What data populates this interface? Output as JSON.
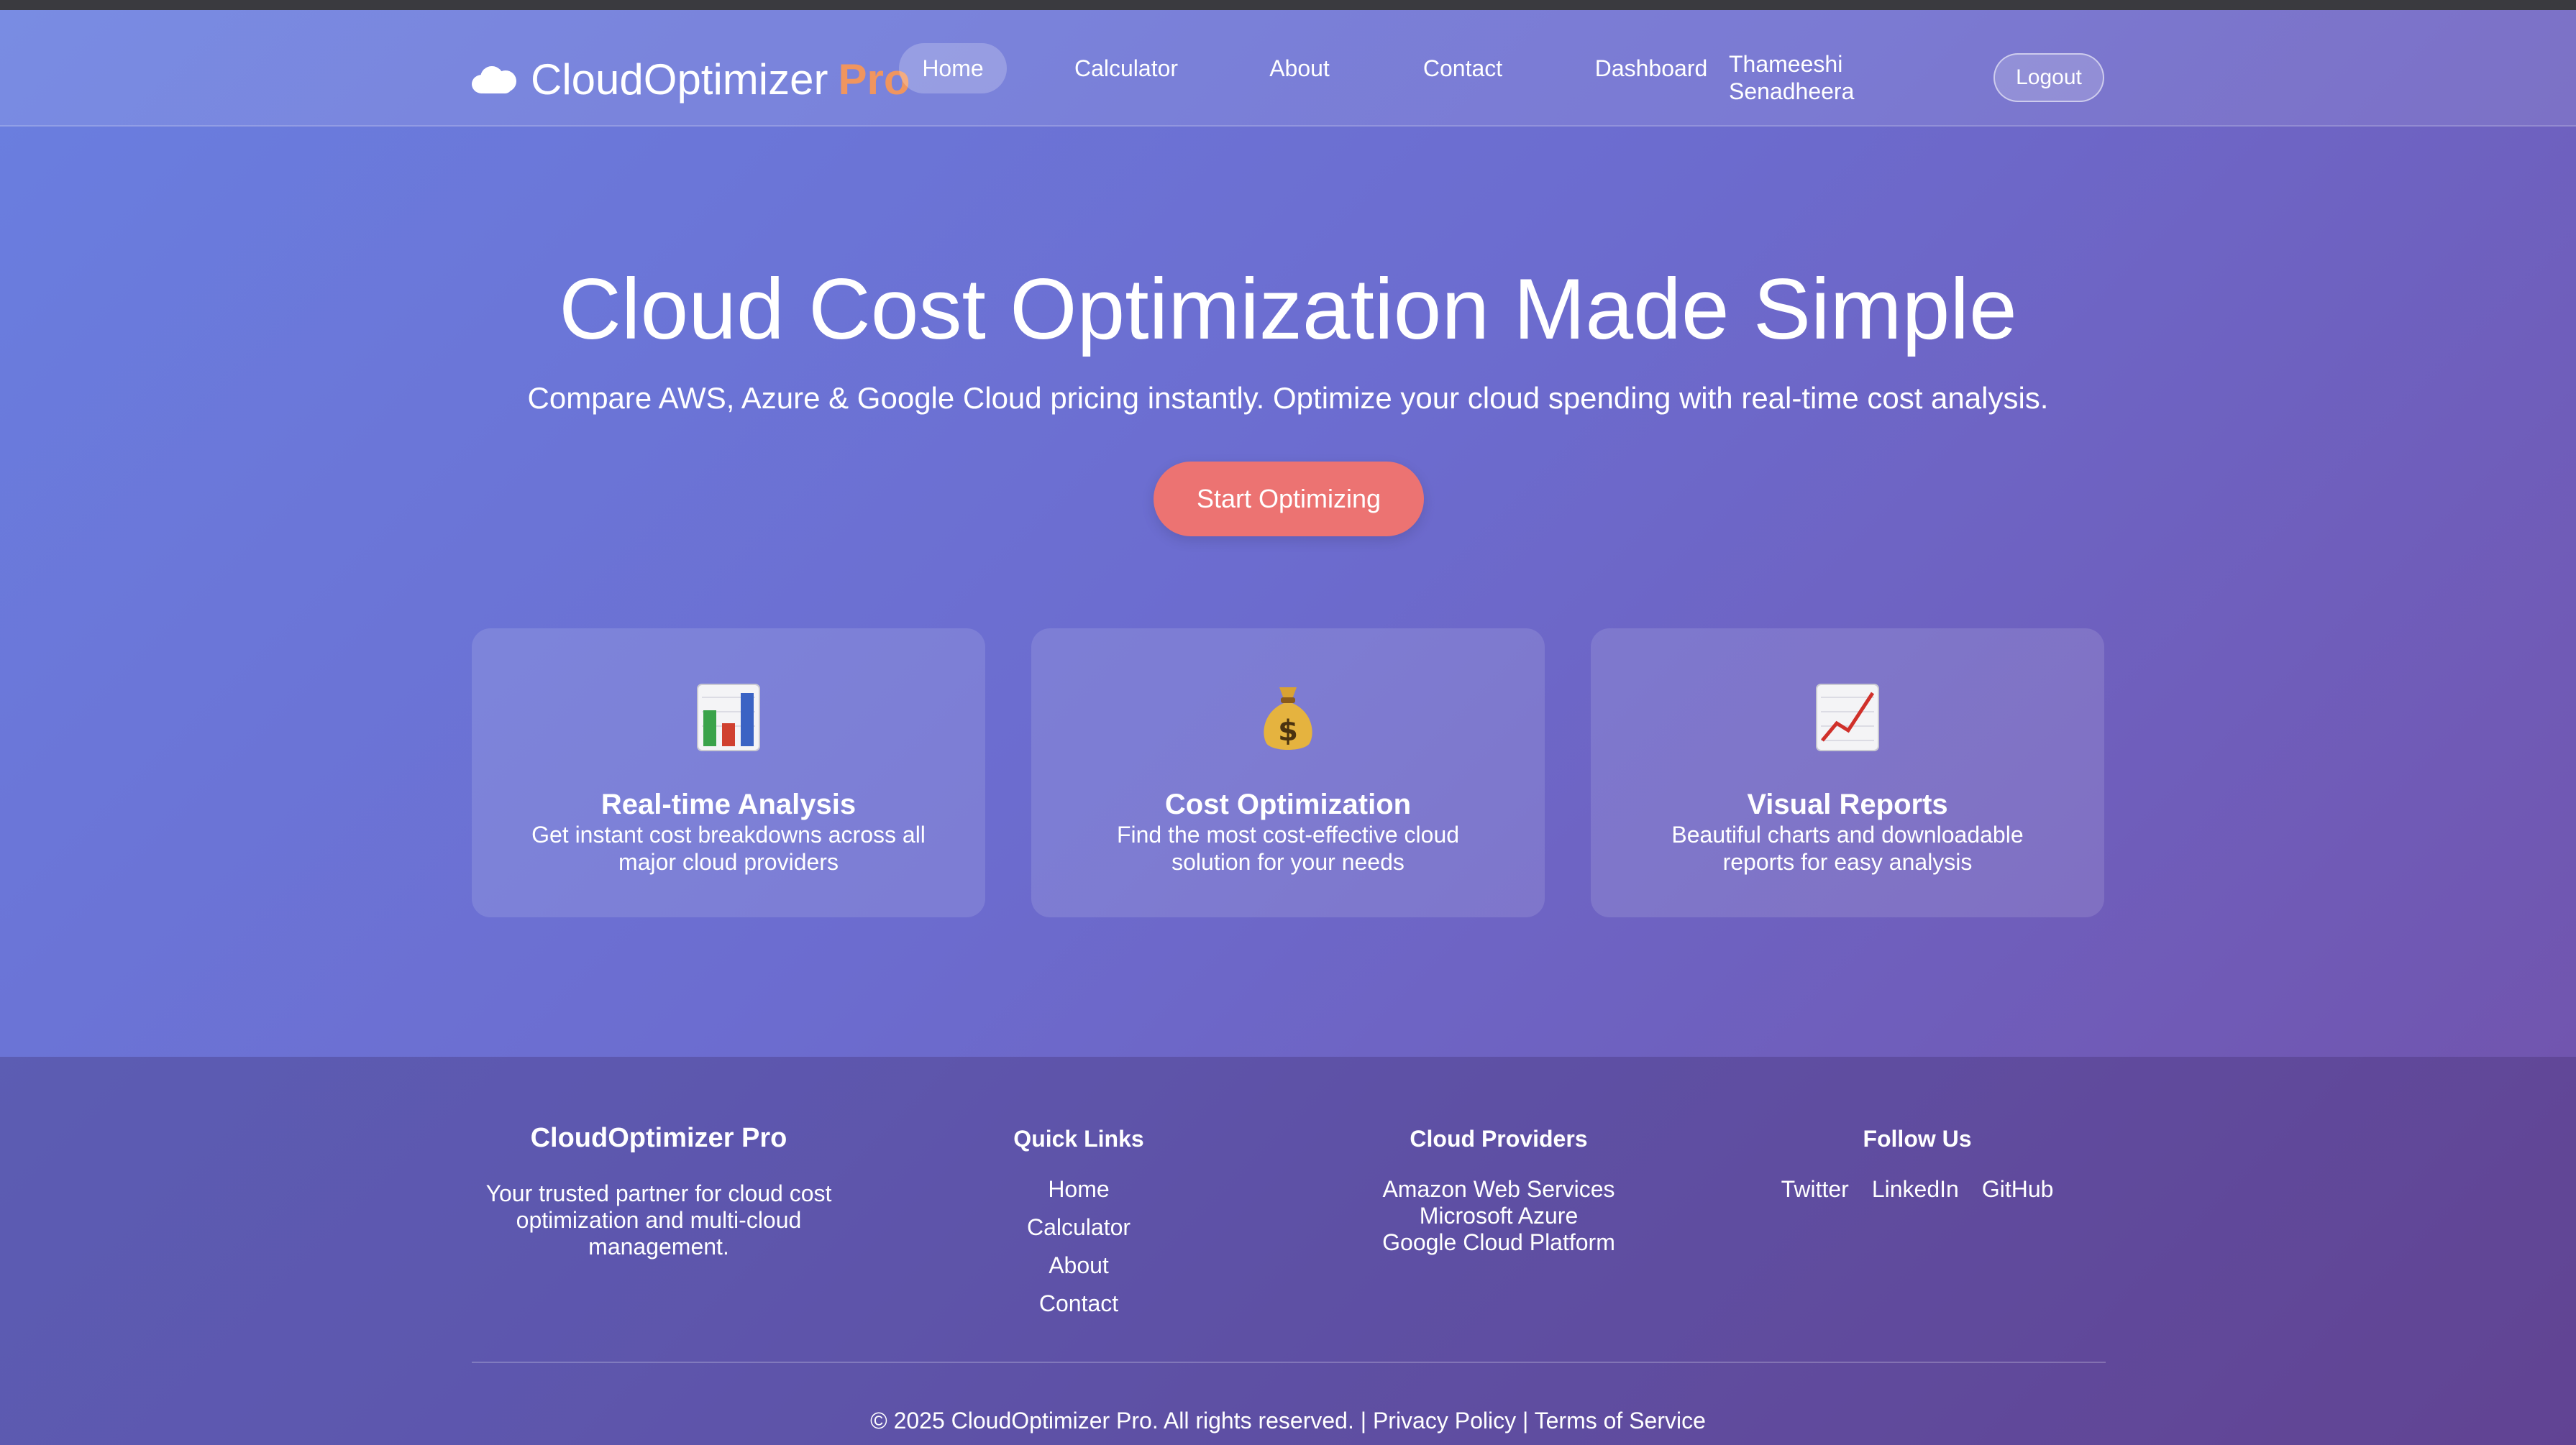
{
  "nav": {
    "logo_text": "CloudOptimizer",
    "logo_accent": "Pro",
    "links": [
      {
        "label": "Home",
        "active": true
      },
      {
        "label": "Calculator"
      },
      {
        "label": "About"
      },
      {
        "label": "Contact"
      },
      {
        "label": "Dashboard"
      }
    ],
    "user_first": "Thameeshi",
    "user_last": "Senadheera",
    "logout_label": "Logout"
  },
  "hero": {
    "title": "Cloud Cost Optimization Made Simple",
    "subtitle": "Compare AWS, Azure & Google Cloud pricing instantly. Optimize your cloud spending with real-time cost analysis.",
    "cta_label": "Start Optimizing"
  },
  "features": [
    {
      "icon": "bar-chart-icon",
      "title": "Real-time Analysis",
      "description": "Get instant cost breakdowns across all major cloud providers"
    },
    {
      "icon": "money-bag-icon",
      "title": "Cost Optimization",
      "description": "Find the most cost-effective cloud solution for your needs"
    },
    {
      "icon": "trend-chart-icon",
      "title": "Visual Reports",
      "description": "Beautiful charts and downloadable reports for easy analysis"
    }
  ],
  "footer": {
    "brand_title": "CloudOptimizer Pro",
    "brand_text": "Your trusted partner for cloud cost optimization and multi-cloud management.",
    "quick_links_title": "Quick Links",
    "quick_links": [
      "Home",
      "Calculator",
      "About",
      "Contact"
    ],
    "providers_title": "Cloud Providers",
    "providers": [
      "Amazon Web Services",
      "Microsoft Azure",
      "Google Cloud Platform"
    ],
    "follow_title": "Follow Us",
    "follow": [
      "Twitter",
      "LinkedIn",
      "GitHub"
    ],
    "copyright": "© 2025 CloudOptimizer Pro. All rights reserved. |",
    "privacy": "Privacy Policy",
    "separator": "|",
    "terms": "Terms of Service"
  },
  "colors": {
    "accent": "#f0955e",
    "cta": "#ec7372",
    "gradient_start": "#6a7fe0",
    "gradient_end": "#7250a8"
  }
}
